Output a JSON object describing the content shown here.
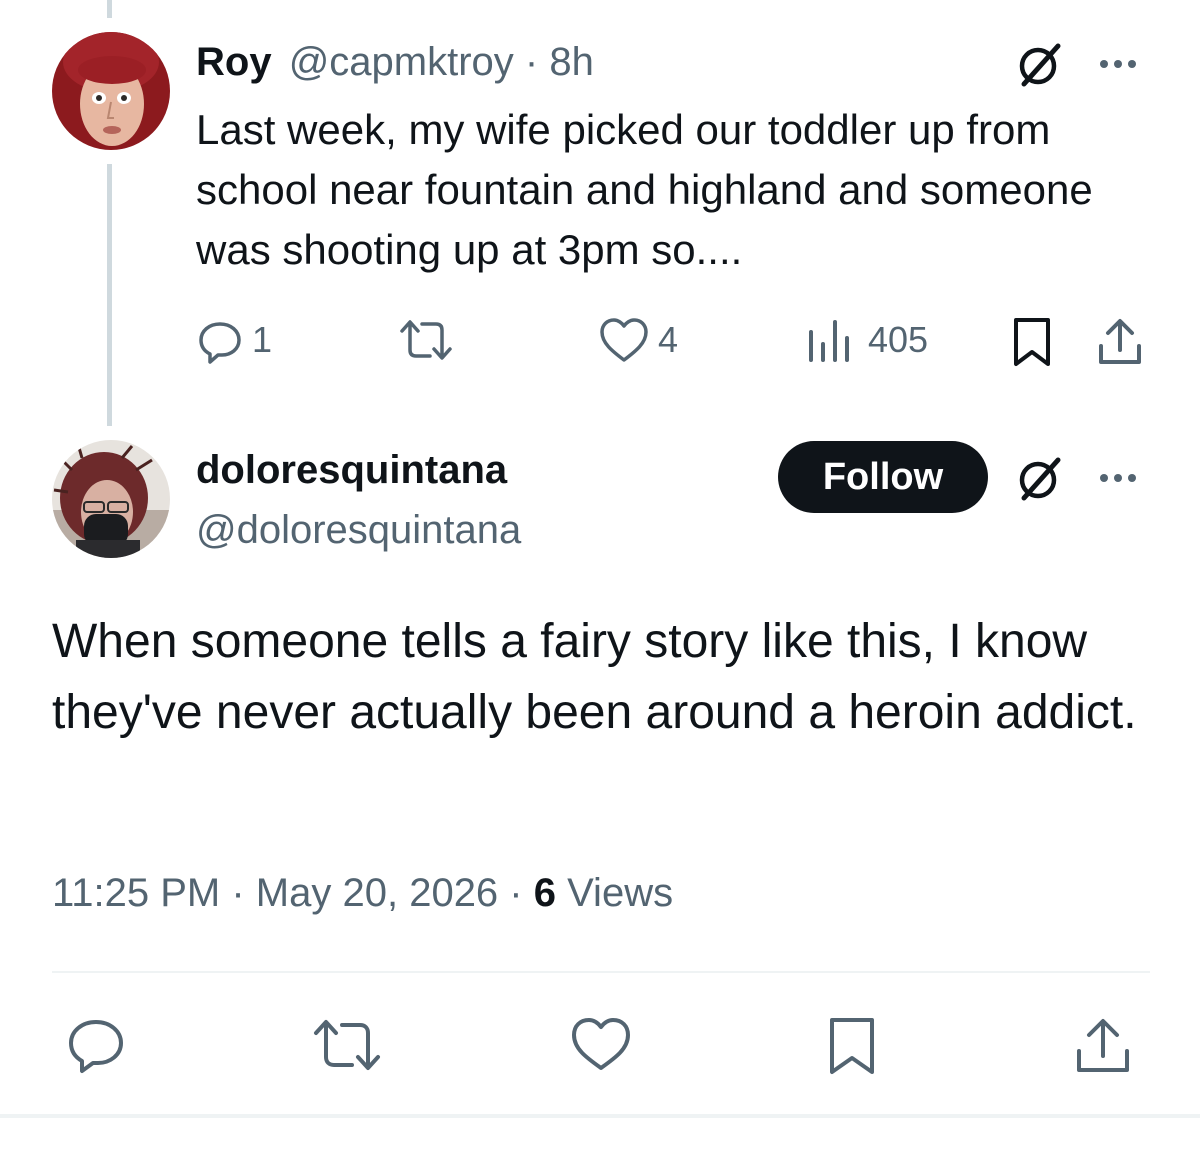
{
  "parent_tweet": {
    "display_name": "Roy",
    "handle": "@capmktroy",
    "separator": " · ",
    "age": "8h",
    "text": "Last week, my wife picked our toddler up from school near fountain and highland and someone was shooting up at 3pm so....",
    "actions": {
      "reply_icon": "reply-icon",
      "reply_count": "1",
      "retweet_icon": "retweet-icon",
      "like_icon": "heart-icon",
      "like_count": "4",
      "views_icon": "views-chart-icon",
      "views_count": "405",
      "bookmark_icon": "bookmark-icon",
      "share_icon": "share-icon"
    }
  },
  "reply_tweet": {
    "display_name": "doloresquintana",
    "handle": "@doloresquintana",
    "follow_label": "Follow",
    "text": "When someone tells a fairy story like this, I know they've never actually been around a heroin addict.",
    "time": "11:25 PM",
    "date": "May 20, 2026",
    "views_count": "6",
    "views_label": " Views",
    "separator": " · "
  },
  "icons": [
    "grok-icon",
    "more-options-icon",
    "reply-icon",
    "retweet-icon",
    "heart-icon",
    "views-chart-icon",
    "bookmark-icon",
    "share-icon"
  ],
  "colors": {
    "text_primary": "#0f1419",
    "text_secondary": "#536471",
    "thread_line": "#cfd9de",
    "divider": "#eff3f4",
    "follow_button_bg": "#0f1419",
    "avatar_roy_bg": "#8c1a1e"
  }
}
